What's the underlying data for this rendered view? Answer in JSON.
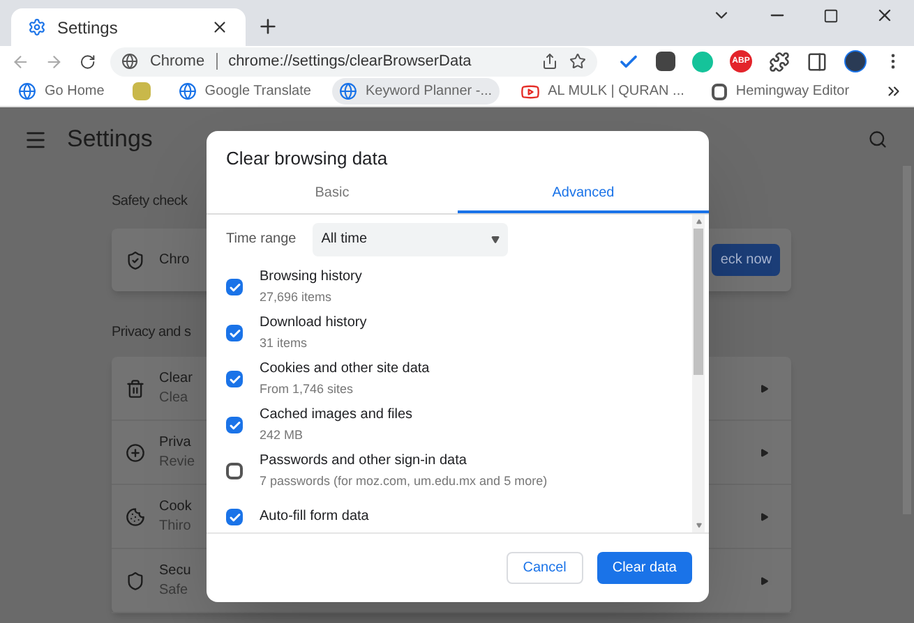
{
  "window": {
    "tab_title": "Settings"
  },
  "address_bar": {
    "origin": "Chrome",
    "url": "chrome://settings/clearBrowserData"
  },
  "extensions": [
    {
      "kind": "check"
    },
    {
      "kind": "square"
    },
    {
      "kind": "circle"
    },
    {
      "kind": "badge",
      "label": "ABP"
    },
    {
      "kind": "puzzle"
    },
    {
      "kind": "panel"
    }
  ],
  "bookmarks": [
    {
      "kind": "page",
      "label": "Go Home",
      "hovered": false
    },
    {
      "kind": "blurred",
      "hovered": false
    },
    {
      "kind": "page",
      "label": "Google Translate",
      "hovered": false
    },
    {
      "kind": "page",
      "label": "Keyword Planner -...",
      "hovered": true
    },
    {
      "kind": "video",
      "label": "AL MULK | QURAN ...",
      "hovered": false
    },
    {
      "kind": "letter",
      "label": "Hemingway Editor",
      "hovered": false
    }
  ],
  "settings": {
    "title": "Settings",
    "safety": {
      "heading": "Safety check",
      "title": "Chro",
      "button": "eck now"
    },
    "privacy": {
      "heading": "Privacy and s",
      "rows": [
        {
          "title": "Clear",
          "detail": "Clea"
        },
        {
          "title": "Priva",
          "detail": "Revie"
        },
        {
          "title": "Cook",
          "detail": "Thiro"
        },
        {
          "title": "Secu",
          "detail": "Safe"
        }
      ]
    }
  },
  "dialog": {
    "title": "Clear browsing data",
    "tabs": [
      {
        "label": "Basic",
        "selected": false
      },
      {
        "label": "Advanced",
        "selected": true
      }
    ],
    "time_range": {
      "label": "Time range",
      "value": "All time"
    },
    "items": [
      {
        "title": "Browsing history",
        "detail": "27,696 items",
        "checked": true
      },
      {
        "title": "Download history",
        "detail": "31 items",
        "checked": true
      },
      {
        "title": "Cookies and other site data",
        "detail": "From 1,746 sites",
        "checked": true
      },
      {
        "title": "Cached images and files",
        "detail": "242 MB",
        "checked": true
      },
      {
        "title": "Passwords and other sign-in data",
        "detail": "7 passwords (for moz.com, um.edu.mx and 5 more)",
        "checked": false
      },
      {
        "title": "Auto-fill form data",
        "checked": true
      }
    ],
    "buttons": [
      {
        "kind": "secondary",
        "label": "Cancel"
      },
      {
        "kind": "primary",
        "label": "Clear data"
      }
    ]
  }
}
